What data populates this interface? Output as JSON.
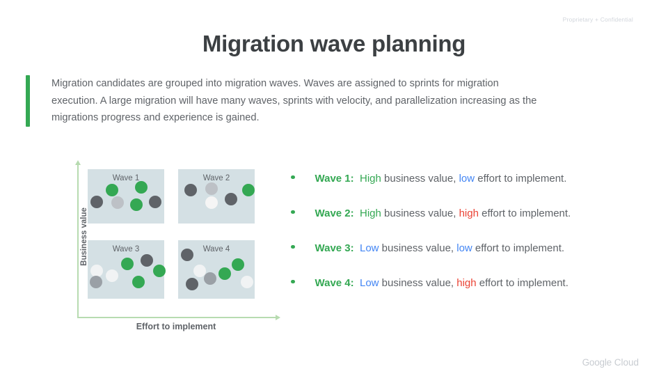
{
  "header": {
    "confidential": "Proprietary + Confidential"
  },
  "title": "Migration wave planning",
  "intro": {
    "paragraph": "Migration candidates are grouped into migration waves. Waves are assigned to sprints for migration execution. A large migration will have many waves, sprints with velocity, and parallelization increasing as the migrations progress and experience is gained."
  },
  "chart_data": {
    "type": "scatter",
    "title": "",
    "xlabel": "Effort to implement",
    "ylabel": "Business value",
    "grid": false,
    "legend": "none",
    "quadrants": [
      {
        "label": "Wave 1",
        "position": "top-left",
        "business_value": "High",
        "effort": "low",
        "points": [
          {
            "color": "#34a853",
            "x": 32,
            "y": 38,
            "r": 9
          },
          {
            "color": "#34a853",
            "x": 70,
            "y": 33,
            "r": 9
          },
          {
            "color": "#5f6368",
            "x": 12,
            "y": 60,
            "r": 9
          },
          {
            "color": "#bdc1c6",
            "x": 39,
            "y": 62,
            "r": 9
          },
          {
            "color": "#34a853",
            "x": 64,
            "y": 66,
            "r": 9
          },
          {
            "color": "#5f6368",
            "x": 88,
            "y": 60,
            "r": 9
          }
        ]
      },
      {
        "label": "Wave 2",
        "position": "top-right",
        "business_value": "High",
        "effort": "high",
        "points": [
          {
            "color": "#5f6368",
            "x": 16,
            "y": 38,
            "r": 9
          },
          {
            "color": "#bdc1c6",
            "x": 44,
            "y": 36,
            "r": 9
          },
          {
            "color": "#34a853",
            "x": 92,
            "y": 39,
            "r": 9
          },
          {
            "color": "#5f6368",
            "x": 69,
            "y": 55,
            "r": 9
          },
          {
            "color": "#f5f5f5",
            "x": 44,
            "y": 62,
            "r": 9
          }
        ]
      },
      {
        "label": "Wave 3",
        "position": "bottom-left",
        "business_value": "Low",
        "effort": "low",
        "points": [
          {
            "color": "#34a853",
            "x": 52,
            "y": 41,
            "r": 9
          },
          {
            "color": "#5f6368",
            "x": 77,
            "y": 35,
            "r": 9
          },
          {
            "color": "#f1f3f4",
            "x": 12,
            "y": 52,
            "r": 9
          },
          {
            "color": "#34a853",
            "x": 94,
            "y": 52,
            "r": 9
          },
          {
            "color": "#f1f3f4",
            "x": 32,
            "y": 61,
            "r": 9
          },
          {
            "color": "#9aa0a6",
            "x": 11,
            "y": 72,
            "r": 9
          },
          {
            "color": "#34a853",
            "x": 66,
            "y": 72,
            "r": 9
          }
        ]
      },
      {
        "label": "Wave 4",
        "position": "bottom-right",
        "business_value": "Low",
        "effort": "high",
        "points": [
          {
            "color": "#5f6368",
            "x": 12,
            "y": 25,
            "r": 9
          },
          {
            "color": "#34a853",
            "x": 78,
            "y": 42,
            "r": 9
          },
          {
            "color": "#f1f3f4",
            "x": 28,
            "y": 52,
            "r": 9
          },
          {
            "color": "#34a853",
            "x": 61,
            "y": 57,
            "r": 9
          },
          {
            "color": "#9aa0a6",
            "x": 42,
            "y": 66,
            "r": 9
          },
          {
            "color": "#5f6368",
            "x": 18,
            "y": 75,
            "r": 9
          },
          {
            "color": "#f1f3f4",
            "x": 90,
            "y": 72,
            "r": 9
          }
        ]
      }
    ]
  },
  "bullets": [
    {
      "wave": "Wave 1:",
      "value_word": "High",
      "value_color": "green",
      "mid_text": " business value, ",
      "effort_word": "low",
      "effort_color": "blue",
      "tail_text": " effort to implement."
    },
    {
      "wave": "Wave 2:",
      "value_word": "High",
      "value_color": "green",
      "mid_text": " business value, ",
      "effort_word": "high",
      "effort_color": "red",
      "tail_text": " effort to implement."
    },
    {
      "wave": "Wave 3:",
      "value_word": "Low",
      "value_color": "blue",
      "mid_text": " business value, ",
      "effort_word": "low",
      "effort_color": "blue",
      "tail_text": " effort to implement."
    },
    {
      "wave": "Wave 4:",
      "value_word": "Low",
      "value_color": "blue",
      "mid_text": " business value, ",
      "effort_word": "high",
      "effort_color": "red",
      "tail_text": " effort to implement."
    }
  ],
  "footer": {
    "brand_google": "Google",
    "brand_cloud": "Cloud"
  },
  "colors": {
    "green": "#34a853",
    "blue": "#4285f4",
    "red": "#ea4335",
    "text_gray": "#5f6368",
    "title_gray": "#3c4043",
    "quadrant_fill": "#d4e0e4",
    "axis_green": "#b7dbb0"
  }
}
